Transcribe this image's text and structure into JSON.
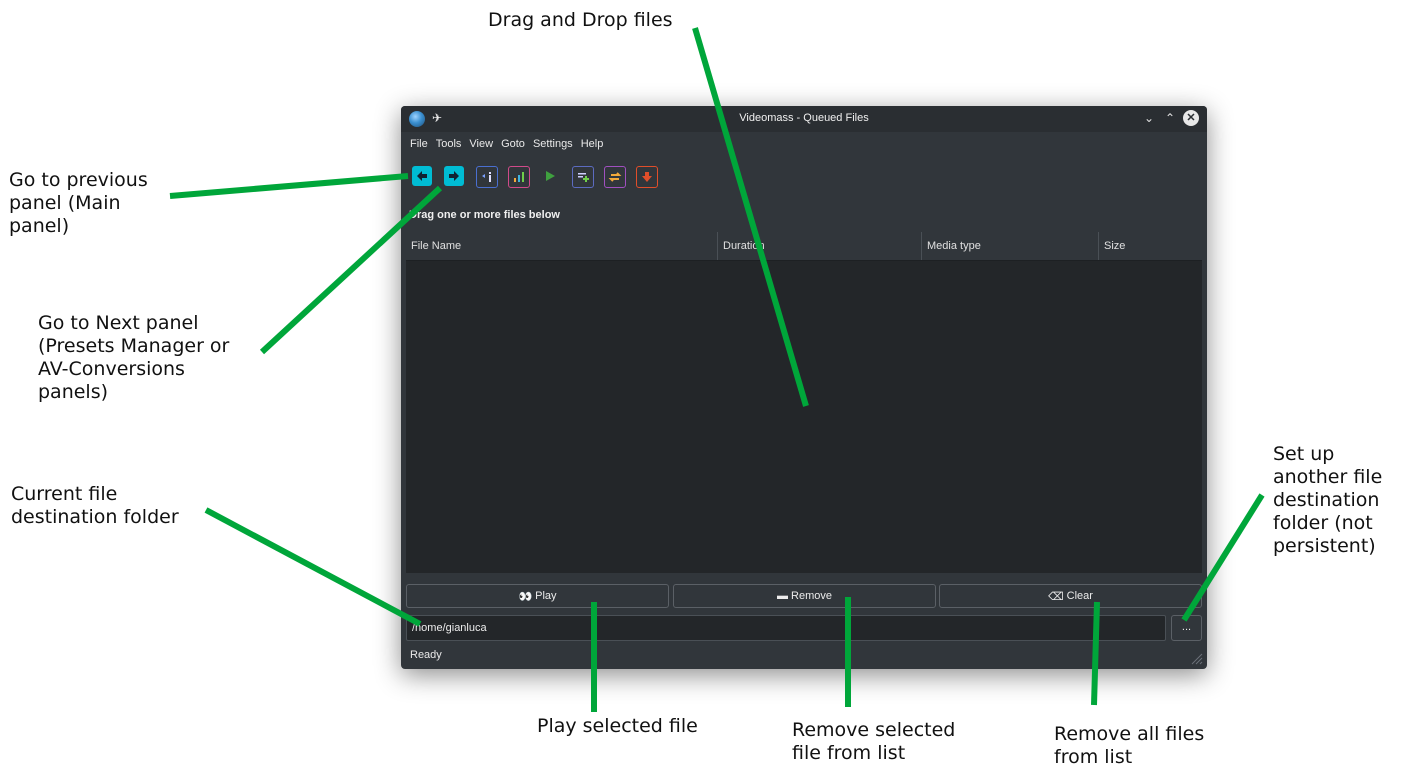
{
  "window": {
    "title": "Videomass - Queued Files",
    "controls": [
      "⌄",
      "⌃",
      "✕"
    ]
  },
  "menu": [
    "File",
    "Tools",
    "View",
    "Goto",
    "Settings",
    "Help"
  ],
  "toolbar": [
    {
      "icon": "go-previous-icon",
      "color": "#00bcd4"
    },
    {
      "icon": "go-next-icon",
      "color": "#00bcd4"
    },
    {
      "icon": "info-icon",
      "color": "#4a6fd0"
    },
    {
      "icon": "chart-icon",
      "color": "#d04a8a"
    },
    {
      "icon": "play-icon",
      "color": "#3fa03f"
    },
    {
      "icon": "add-list-icon",
      "color": "#5c6bc0"
    },
    {
      "icon": "convert-icon",
      "color": "#a050c0"
    },
    {
      "icon": "download-icon",
      "color": "#e04e2a"
    }
  ],
  "drag_label": "Drag one or more files below",
  "columns": [
    "File Name",
    "Duration",
    "Media type",
    "Size"
  ],
  "buttons": {
    "play": "Play",
    "remove": "Remove",
    "clear": "Clear"
  },
  "destination": {
    "path": "/home/gianluca",
    "browse": "..."
  },
  "status": "Ready",
  "annotations": {
    "drag_drop": "Drag and Drop files",
    "prev_panel": [
      "Go to previous",
      "panel (Main",
      "panel)"
    ],
    "next_panel": [
      "Go to Next panel",
      "(Presets Manager or",
      "AV-Conversions",
      "panels)"
    ],
    "dest_folder": [
      "Current file",
      "destination folder"
    ],
    "setup_folder": [
      "Set up",
      "another file",
      "destination",
      "folder (not",
      "persistent)"
    ],
    "play_sel": "Play selected file",
    "remove_sel": [
      "Remove selected",
      "file from list"
    ],
    "remove_all": [
      "Remove all files",
      "from list"
    ]
  },
  "colors": {
    "annotation_line": "#00a63a",
    "window_bg": "#31363b",
    "list_bg": "#232629"
  }
}
